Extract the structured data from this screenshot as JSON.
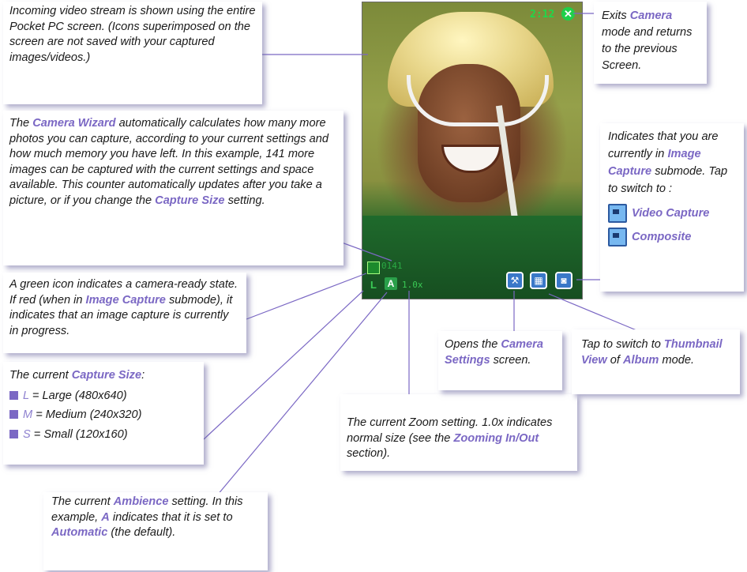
{
  "screen": {
    "time": "2:12",
    "exit_icon": "close-icon",
    "counter": "0141",
    "capture_size": "L",
    "ambience": "A",
    "zoom": "1.0x"
  },
  "callouts": {
    "stream": "Incoming video stream is shown using the entire Pocket PC screen. (Icons superimposed on the screen are not saved with your captured images/videos.)",
    "wizard": {
      "p1": "The ",
      "h1": "Camera Wizard",
      "p2": " automatically calculates how many more photos you can capture, according to your current settings and how much memory you have left.  In this example, 141 more images can be captured with the current settings and space available.  This counter automatically updates after you take a picture, or if you change the ",
      "h2": "Capture Size",
      "p3": " setting."
    },
    "green": {
      "p1": "A green icon indicates a camera-ready state.  If red (when in ",
      "h1": "Image Capture",
      "p2": " submode), it indicates that an image capture is currently in progress."
    },
    "size": {
      "p1": "The current ",
      "h1": "Capture Size",
      "p2": ":",
      "items": [
        {
          "letter": "L",
          "text": " = Large (480x640)"
        },
        {
          "letter": "M",
          "text": " = Medium (240x320)"
        },
        {
          "letter": "S",
          "text": " = Small (120x160)"
        }
      ]
    },
    "ambience": {
      "p1": "The current ",
      "h1": "Ambience",
      "p2": " setting. In this example, ",
      "h2": "A",
      "p3": " indicates that it is set to ",
      "h3": "Automatic",
      "p4": " (the default)."
    },
    "zoom": {
      "p1": "The current Zoom setting. 1.0x indicates normal size (see the ",
      "h1": "Zooming In/Out",
      "p2": " section)."
    },
    "settings": {
      "p1": "Opens the ",
      "h1": "Camera Settings",
      "p2": " screen."
    },
    "thumb": {
      "p1": "Tap to switch to ",
      "h1": "Thumbnail View",
      "p2": " of ",
      "h2": "Album",
      "p3": " mode."
    },
    "exits": {
      "p1": "Exits ",
      "h1": "Camera",
      "p2": " mode and returns to the previous Screen."
    },
    "submode": {
      "p1": "Indicates that you are currently in ",
      "h1": "Image Capture",
      "p2": " submode.  Tap to switch to :",
      "video": "Video Capture",
      "composite": "Composite"
    }
  }
}
